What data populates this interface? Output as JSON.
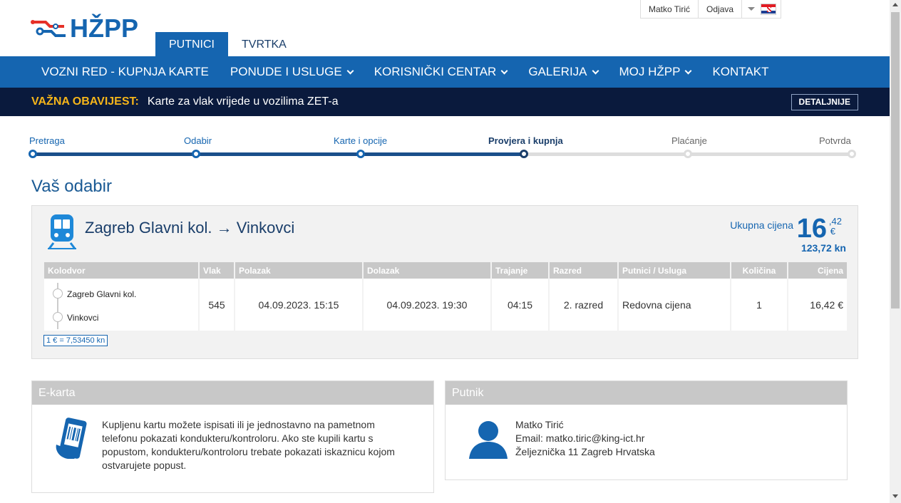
{
  "brand": {
    "logo_text": "HŽPP",
    "accent": "#1565b0",
    "dark": "#0a1a3d",
    "warning": "#f5b51a"
  },
  "main_tabs": [
    {
      "label": "PUTNICI",
      "active": true
    },
    {
      "label": "TVRTKA",
      "active": false
    }
  ],
  "user_bar": {
    "user_name": "Matko Tirić",
    "logout": "Odjava",
    "language_icon": "croatian-flag-icon"
  },
  "nav": [
    {
      "label": "VOZNI RED - KUPNJA KARTE",
      "dropdown": false
    },
    {
      "label": "PONUDE I USLUGE",
      "dropdown": true
    },
    {
      "label": "KORISNIČKI CENTAR",
      "dropdown": true
    },
    {
      "label": "GALERIJA",
      "dropdown": true
    },
    {
      "label": "MOJ HŽPP",
      "dropdown": true
    },
    {
      "label": "KONTAKT",
      "dropdown": false
    }
  ],
  "notice": {
    "label": "VAŽNA OBAVIJEST:",
    "text": "Karte za vlak vrijede u vozilima ZET-a",
    "button": "DETALJNIJE"
  },
  "steps": [
    {
      "label": "Pretraga",
      "state": "done"
    },
    {
      "label": "Odabir",
      "state": "done"
    },
    {
      "label": "Karte i opcije",
      "state": "done"
    },
    {
      "label": "Provjera i kupnja",
      "state": "current"
    },
    {
      "label": "Plaćanje",
      "state": "future"
    },
    {
      "label": "Potvrda",
      "state": "future"
    }
  ],
  "section_title": "Vaš odabir",
  "selection": {
    "route": "Zagreb Glavni kol. → Vinkovci",
    "total_label": "Ukupna cijena",
    "total_int": "16",
    "total_dec": ",42",
    "total_currency": "€",
    "total_kn": "123,72 kn",
    "columns": [
      "Kolodvor",
      "Vlak",
      "Polazak",
      "Dolazak",
      "Trajanje",
      "Razred",
      "Putnici / Usluga",
      "Količina",
      "Cijena"
    ],
    "row": {
      "from": "Zagreb Glavni kol.",
      "to": "Vinkovci",
      "train": "545",
      "departure": "04.09.2023. 15:15",
      "arrival": "04.09.2023. 19:30",
      "duration": "04:15",
      "class": "2. razred",
      "passenger": "Redovna cijena",
      "quantity": "1",
      "price": "16,42 €"
    },
    "rate": "1 € = 7,53450 kn"
  },
  "ekarta": {
    "title": "E-karta",
    "text": "Kupljenu kartu možete ispisati ili je jednostavno na pametnom telefonu pokazati kondukteru/kontroloru. Ako ste kupili kartu s popustom, kondukteru/kontroloru trebate pokazati iskaznicu kojom ostvarujete popust."
  },
  "putnik": {
    "title": "Putnik",
    "name": "Matko Tirić",
    "email": "Email: matko.tiric@king-ict.hr",
    "address": "Željeznička 11 Zagreb Hrvatska"
  }
}
